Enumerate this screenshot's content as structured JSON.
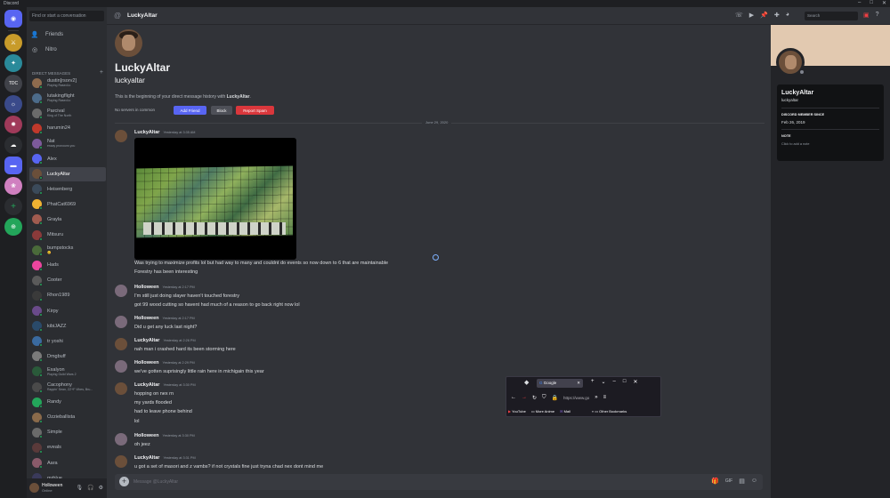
{
  "window": {
    "title": "Discord"
  },
  "sidebar": {
    "search_placeholder": "Find or start a conversation",
    "nav": [
      {
        "label": "Friends",
        "icon": "friends-icon"
      },
      {
        "label": "Nitro",
        "icon": "nitro-icon"
      }
    ],
    "dm_header": "DIRECT MESSAGES",
    "dm_add": "+",
    "dms": [
      {
        "name": "dustin[rsorv2]",
        "sub": "Playing Rased.io",
        "color": "#8e6b4e"
      },
      {
        "name": "lutakingflight",
        "sub": "Playing Rased.io",
        "color": "#4c6b8a"
      },
      {
        "name": "Parcival",
        "sub": "King of The North",
        "color": "#6b6b6b"
      },
      {
        "name": "harumin24",
        "sub": "",
        "color": "#c0392b"
      },
      {
        "name": "Nat",
        "sub": "essay pronouns you",
        "color": "#7d5a9b"
      },
      {
        "name": "Alex",
        "sub": "",
        "color": "#5865f2"
      },
      {
        "name": "LuckyAltar",
        "sub": "",
        "color": "#6b4f3a"
      },
      {
        "name": "Heisenberg",
        "sub": "",
        "color": "#3b4a5a"
      },
      {
        "name": "PhatCat6969",
        "sub": "",
        "color": "#f0b232"
      },
      {
        "name": "Grayla",
        "sub": "",
        "color": "#a05b4f"
      },
      {
        "name": "Mitsuru",
        "sub": "",
        "color": "#8a3a3a"
      },
      {
        "name": "bumpstocks",
        "sub": "😊",
        "color": "#4a6a3a"
      },
      {
        "name": "Hads",
        "sub": "",
        "color": "#eb459e"
      },
      {
        "name": "Cooter",
        "sub": "",
        "color": "#5a5a5a"
      },
      {
        "name": "Rhon1989",
        "sub": "",
        "color": "#3a3a3a"
      },
      {
        "name": "Kirpy",
        "sub": "",
        "color": "#6a4a8a"
      },
      {
        "name": "kibiJAZZ",
        "sub": "",
        "color": "#2a4a6a"
      },
      {
        "name": "tr yoshi",
        "sub": "",
        "color": "#3a6aa0"
      },
      {
        "name": "Dmgbuff",
        "sub": "",
        "color": "#7a7a7a"
      },
      {
        "name": "Exalyon",
        "sub": "Playing Guild Wars 2",
        "color": "#2a5a3a"
      },
      {
        "name": "Cacophony",
        "sub": "Rappin' Sean, ZZ+F Vibes, Bru...",
        "color": "#4a4a4a"
      },
      {
        "name": "Randy",
        "sub": "",
        "color": "#23a55a"
      },
      {
        "name": "Ozzieballista",
        "sub": "",
        "color": "#8a6a4a"
      },
      {
        "name": "Simple",
        "sub": "",
        "color": "#6a6a6a"
      },
      {
        "name": "eveals",
        "sub": "",
        "color": "#5a3a3a"
      },
      {
        "name": "Aara",
        "sub": "",
        "color": "#8a5a6a"
      },
      {
        "name": "mrblue",
        "sub": "",
        "color": "#3a3a5a"
      }
    ]
  },
  "user": {
    "name": "Holloween",
    "status": "Online"
  },
  "header": {
    "title": "LuckyAltar",
    "search_placeholder": "Search"
  },
  "intro": {
    "name": "LuckyAltar",
    "username": "luckyaltar",
    "text_before": "This is the beginning of your direct message history with ",
    "text_name": "LuckyAltar",
    "text_after": ".",
    "no_servers": "No servers in common",
    "add_friend": "Add Friend",
    "block": "Block",
    "report": "Report Spam"
  },
  "date_divider": "June 29, 2020",
  "messages": [
    {
      "author": "LuckyAltar",
      "time": "Yesterday at 3:35 AM",
      "color": "#6b4f3a",
      "lines": []
    },
    {
      "author": "",
      "time": "",
      "color": "",
      "lines": [
        "Was trying to maximize profits lol but had way to many and couldnt do events so now down to 6 that are maintainable",
        "Forestry has been interesting"
      ]
    },
    {
      "author": "Holloween",
      "time": "Yesterday at 2:17 PM",
      "color": "#7a6a7a",
      "lines": [
        "I'm still just doing slayer haven't touched forestry",
        "got 99 wood cutting so havent had much of a reason to go back right now lol"
      ]
    },
    {
      "author": "Holloween",
      "time": "Yesterday at 2:17 PM",
      "color": "#7a6a7a",
      "lines": [
        "Did u get any luck last night?"
      ]
    },
    {
      "author": "LuckyAltar",
      "time": "Yesterday at 2:26 PM",
      "color": "#6b4f3a",
      "lines": [
        "nah man i crashed hard its been storming here"
      ]
    },
    {
      "author": "Holloween",
      "time": "Yesterday at 2:29 PM",
      "color": "#7a6a7a",
      "lines": [
        "we've gotten suprisingly little rain here in michigain this year"
      ]
    },
    {
      "author": "LuckyAltar",
      "time": "Yesterday at 3:30 PM",
      "color": "#6b4f3a",
      "lines": [
        "hopping on nex rn",
        "my yards flooded",
        "had to leave phone behind",
        "lol"
      ]
    },
    {
      "author": "Holloween",
      "time": "Yesterday at 3:30 PM",
      "color": "#7a6a7a",
      "lines": [
        "oh jeez"
      ]
    },
    {
      "author": "LuckyAltar",
      "time": "Yesterday at 3:31 PM",
      "color": "#6b4f3a",
      "lines": [
        "u got a set of masori and z vambs? if not crystals fine just tryna chad nex dont mind me"
      ]
    }
  ],
  "composer": {
    "placeholder": "Message @LuckyAltar"
  },
  "browser": {
    "tab_label": "Google",
    "url": "https://www.go",
    "bookmarks": [
      "YouTube",
      "More Anime",
      "Mail",
      "Other Bookmarks"
    ]
  },
  "profile": {
    "name": "LuckyAltar",
    "username": "luckyaltar",
    "member_since_label": "DISCORD MEMBER SINCE",
    "member_since": "Feb 26, 2019",
    "note_label": "NOTE",
    "note_placeholder": "Click to add a note"
  }
}
